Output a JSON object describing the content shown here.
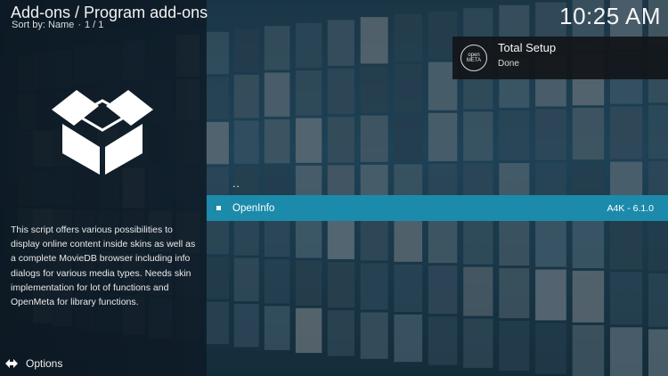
{
  "header": {
    "title": "Add-ons / Program add-ons",
    "sort_label": "Sort by: Name",
    "separator": "·",
    "page": "1 / 1"
  },
  "clock": "10:25 AM",
  "notification": {
    "logo_line1": "open",
    "logo_line2": "META",
    "title": "Total Setup",
    "message": "Done"
  },
  "addon": {
    "icon": "open-box-icon",
    "description": "This script offers various possibilities to display online content inside skins as well as a complete MovieDB browser including info dialogs for various media types. Needs skin implementation for lot of functions and OpenMeta for library functions."
  },
  "list": {
    "parent_label": "..",
    "items": [
      {
        "name": "OpenInfo",
        "version": "A4K - 6.1.0",
        "selected": true
      }
    ]
  },
  "footer": {
    "options_label": "Options",
    "options_icon": "options-arrows-icon"
  },
  "colors": {
    "highlight": "#1c8bab",
    "panel": "#0e1b26"
  }
}
